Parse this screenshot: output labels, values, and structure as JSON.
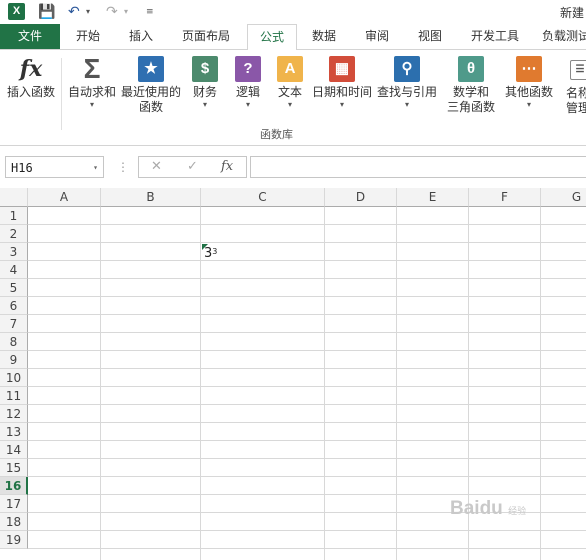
{
  "app": {
    "doc_title": "新建"
  },
  "tabs": [
    "文件",
    "开始",
    "插入",
    "页面布局",
    "公式",
    "数据",
    "审阅",
    "视图",
    "开发工具",
    "负载测试"
  ],
  "ribbon": {
    "buttons": [
      {
        "label": "插入函数",
        "icon": "fx-icon"
      },
      {
        "label": "自动求和",
        "icon": "sigma-icon"
      },
      {
        "label": "最近使用的\n函数",
        "icon": "star-book-icon"
      },
      {
        "label": "财务",
        "icon": "money-book-icon"
      },
      {
        "label": "逻辑",
        "icon": "question-book-icon"
      },
      {
        "label": "文本",
        "icon": "text-book-icon"
      },
      {
        "label": "日期和时间",
        "icon": "calendar-book-icon"
      },
      {
        "label": "查找与引用",
        "icon": "search-book-icon"
      },
      {
        "label": "数学和\n三角函数",
        "icon": "theta-book-icon"
      },
      {
        "label": "其他函数",
        "icon": "more-book-icon"
      },
      {
        "label": "名称\n管理",
        "icon": "name-manager-icon"
      }
    ],
    "group_label": "函数库"
  },
  "formula_bar": {
    "name_box": "H16",
    "formula": "",
    "fx_label": "fx"
  },
  "columns": [
    "A",
    "B",
    "C",
    "D",
    "E",
    "F",
    "G"
  ],
  "rows": [
    "1",
    "2",
    "3",
    "4",
    "5",
    "6",
    "7",
    "8",
    "9",
    "10",
    "11",
    "12",
    "13",
    "14",
    "15",
    "16",
    "17",
    "18",
    "19"
  ],
  "selected_row": "16",
  "cells": {
    "C3": {
      "base": "3",
      "superscript": "3"
    }
  },
  "watermark": {
    "text": "Bai",
    "suffix": "du",
    "sub": "经验"
  },
  "colors": {
    "accent": "#217346",
    "excel_icon": "#1e7145"
  }
}
